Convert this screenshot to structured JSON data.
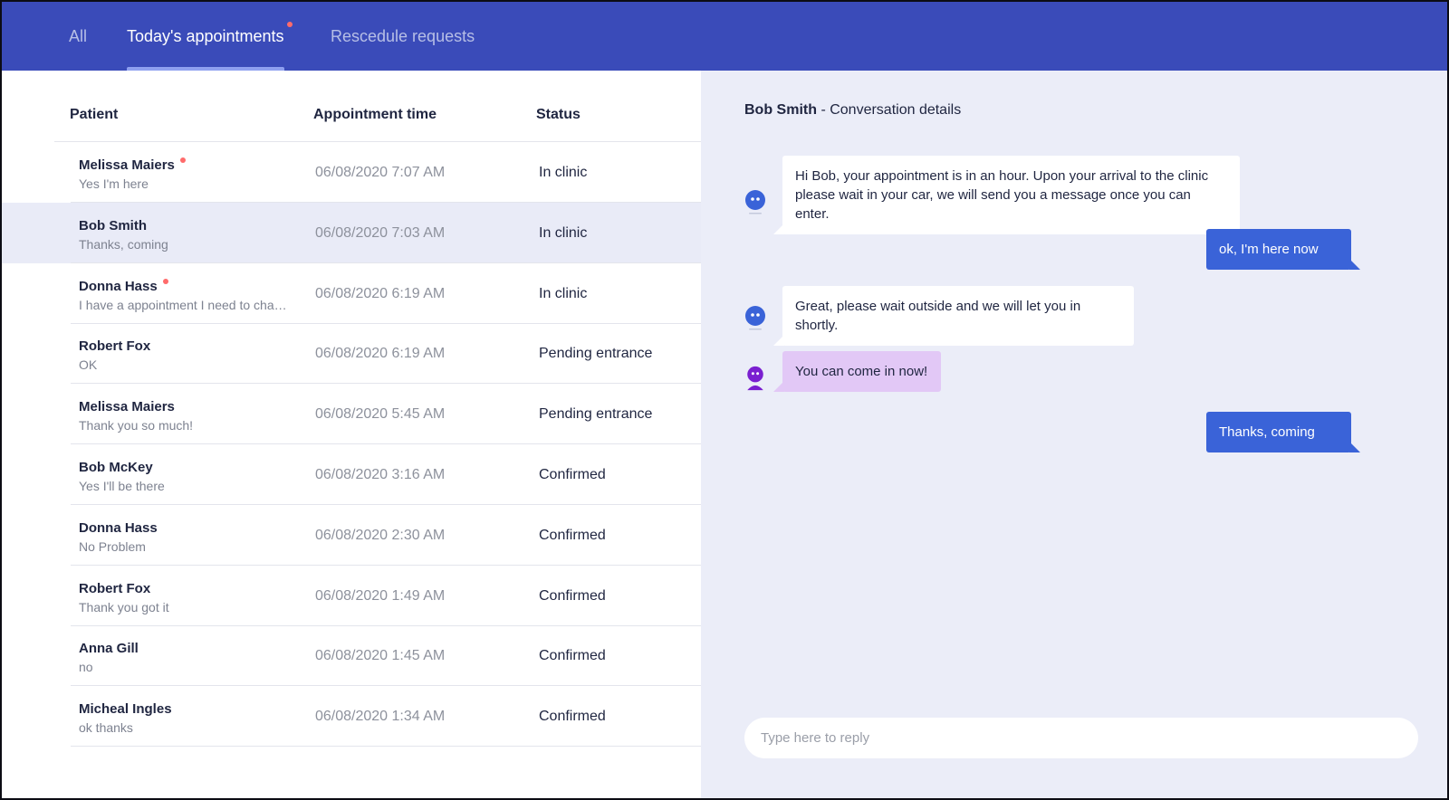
{
  "tabs": [
    {
      "label": "All",
      "active": false,
      "has_dot": false
    },
    {
      "label": "Today's appointments",
      "active": true,
      "has_dot": true
    },
    {
      "label": "Rescedule requests",
      "active": false,
      "has_dot": false
    }
  ],
  "list": {
    "columns": {
      "patient": "Patient",
      "time": "Appointment time",
      "status": "Status"
    },
    "rows": [
      {
        "name": "Melissa Maiers",
        "message": "Yes I'm here",
        "time": "06/08/2020 7:07 AM",
        "status": "In clinic",
        "unread": true,
        "selected": false
      },
      {
        "name": "Bob Smith",
        "message": "Thanks, coming",
        "time": "06/08/2020 7:03 AM",
        "status": "In clinic",
        "unread": false,
        "selected": true
      },
      {
        "name": "Donna Hass",
        "message": "I have a appointment I need to change",
        "time": "06/08/2020 6:19 AM",
        "status": "In clinic",
        "unread": true,
        "selected": false
      },
      {
        "name": "Robert Fox",
        "message": "OK",
        "time": "06/08/2020 6:19 AM",
        "status": "Pending entrance",
        "unread": false,
        "selected": false
      },
      {
        "name": "Melissa Maiers",
        "message": "Thank you so much!",
        "time": "06/08/2020 5:45 AM",
        "status": "Pending entrance",
        "unread": false,
        "selected": false
      },
      {
        "name": "Bob McKey",
        "message": "Yes I'll be there",
        "time": "06/08/2020 3:16 AM",
        "status": "Confirmed",
        "unread": false,
        "selected": false
      },
      {
        "name": "Donna Hass",
        "message": "No Problem",
        "time": "06/08/2020 2:30 AM",
        "status": "Confirmed",
        "unread": false,
        "selected": false
      },
      {
        "name": "Robert Fox",
        "message": "Thank you got it",
        "time": "06/08/2020 1:49 AM",
        "status": "Confirmed",
        "unread": false,
        "selected": false
      },
      {
        "name": "Anna Gill",
        "message": "no",
        "time": "06/08/2020 1:45 AM",
        "status": "Confirmed",
        "unread": false,
        "selected": false
      },
      {
        "name": "Micheal Ingles",
        "message": "ok thanks",
        "time": "06/08/2020 1:34 AM",
        "status": "Confirmed",
        "unread": false,
        "selected": false
      }
    ]
  },
  "conversation": {
    "patient_name": "Bob Smith",
    "title_suffix": " - Conversation details",
    "messages": [
      {
        "sender": "bot",
        "text": "Hi Bob, your appointment is in an hour. Upon your arrival to the clinic please wait in your car, we will send you a message once you can enter."
      },
      {
        "sender": "patient",
        "text": "ok, I'm here now"
      },
      {
        "sender": "bot",
        "text": "Great, please wait outside and we will let you in shortly."
      },
      {
        "sender": "staff",
        "text": "You can come in now!"
      },
      {
        "sender": "patient",
        "text": "Thanks, coming"
      }
    ],
    "reply_placeholder": "Type here to reply"
  },
  "colors": {
    "header": "#3a4bb9",
    "patient_bubble": "#3a63d8",
    "staff_bubble": "#e2c8f6",
    "bot_avatar": "#3a63d8",
    "staff_avatar": "#7a1fd0",
    "unread_dot": "#ff6b6b"
  },
  "icons": {
    "bot_avatar": "bot-avatar-icon",
    "staff_avatar": "staff-avatar-icon"
  }
}
